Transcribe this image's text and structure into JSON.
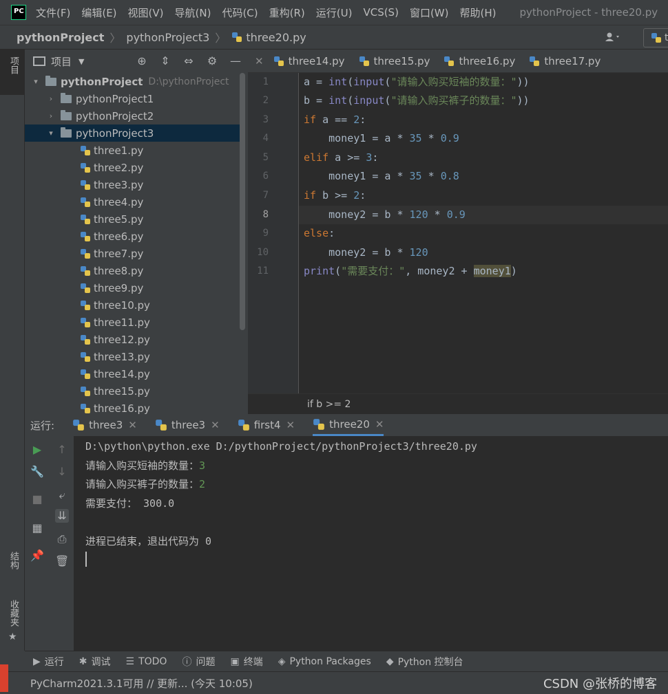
{
  "menubar": {
    "items": [
      "文件(F)",
      "编辑(E)",
      "视图(V)",
      "导航(N)",
      "代码(C)",
      "重构(R)",
      "运行(U)",
      "VCS(S)",
      "窗口(W)",
      "帮助(H)"
    ],
    "window_title": "pythonProject - three20.py"
  },
  "navbar": {
    "crumbs": [
      "pythonProject",
      "pythonProject3",
      "three20.py"
    ],
    "run_config_partial": "th"
  },
  "leftstrip": {
    "project_label": "项目",
    "structure_label": "结构",
    "favorites_label": "收藏夹"
  },
  "project": {
    "header_label": "项目",
    "root_name": "pythonProject",
    "root_path": "D:\\pythonProject",
    "folders": [
      "pythonProject1",
      "pythonProject2",
      "pythonProject3"
    ],
    "files": [
      "three1.py",
      "three2.py",
      "three3.py",
      "three4.py",
      "three5.py",
      "three6.py",
      "three7.py",
      "three8.py",
      "three9.py",
      "three10.py",
      "three11.py",
      "three12.py",
      "three13.py",
      "three14.py",
      "three15.py",
      "three16.py"
    ]
  },
  "editor": {
    "tabs": [
      "three14.py",
      "three15.py",
      "three16.py",
      "three17.py"
    ],
    "line_numbers": [
      "1",
      "2",
      "3",
      "4",
      "5",
      "6",
      "7",
      "8",
      "9",
      "10",
      "11"
    ],
    "current_line": 8,
    "breadcrumb_status": "if b >= 2"
  },
  "run": {
    "label": "运行:",
    "tabs": [
      "three3",
      "three3",
      "first4",
      "three20"
    ],
    "active_tab": "three20",
    "console": {
      "cmd": "D:\\python\\python.exe D:/pythonProject/pythonProject3/three20.py",
      "prompt1": "请输入购买短袖的数量：",
      "input1": "3",
      "prompt2": "请输入购买裤子的数量：",
      "input2": "2",
      "result": "需要支付： 300.0",
      "exit": "进程已结束，退出代码为 0"
    }
  },
  "bottombar": {
    "items": [
      "运行",
      "调试",
      "TODO",
      "问题",
      "终端",
      "Python Packages",
      "Python 控制台"
    ]
  },
  "status": {
    "message": "PyCharm2021.3.1可用 // 更新... (今天 10:05)",
    "watermark": "CSDN @张桥的博客"
  }
}
